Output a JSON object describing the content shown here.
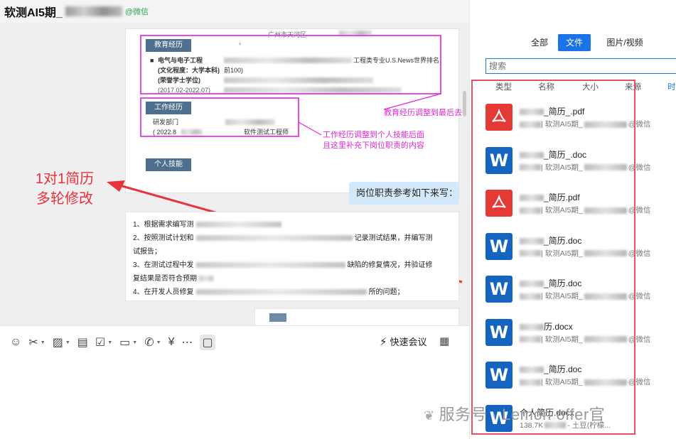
{
  "title": {
    "text": "软测AI5期_",
    "source": "@微信"
  },
  "resume": {
    "education_label": "教育经历",
    "work_label": "工作经历",
    "skills_label": "个人技能",
    "school_line": "电气与电子工程",
    "degree_line": "(文化程度：大学本科)",
    "bachelor_line": "(荣誉学士学位)",
    "date_line": "(2017.02-2022.07)",
    "rank_line": "工程类专业U.S.News世界排名",
    "rank_sub": "前100)",
    "work_dept": "研发部门",
    "work_date": "( 2022.8",
    "work_title": "软件测试工程师",
    "location": "广州市天河区",
    "edu_note": "教育经历调整到最后去",
    "work_note_1": "工作经历调整到个人技能后面",
    "work_note_2": "且这里补充下岗位职责的内容"
  },
  "annotation": {
    "line1": "1对1简历",
    "line2": "多轮修改"
  },
  "chat": {
    "bubble": "岗位职责参考如下来写：",
    "duties": [
      {
        "n": "1、根据需求编写测",
        "tail": ""
      },
      {
        "n": "2、按照测试计划和",
        "tail": "记录测试结果，并编写测"
      },
      {
        "n": "试报告；",
        "tail": ""
      },
      {
        "n": "3、在测试过程中发",
        "tail": "缺陷的修复情况，并验证修"
      },
      {
        "n": "复结果是否符合预期",
        "tail": ""
      },
      {
        "n": "4、在开发人员修复",
        "tail": "所的问题；"
      }
    ]
  },
  "toolbar": {
    "meeting": "快速会议"
  },
  "right_panel": {
    "tabs": [
      "全部",
      "文件",
      "图片/视频"
    ],
    "active_tab": 1,
    "search_placeholder": "搜索",
    "columns": [
      "类型",
      "名称",
      "大小",
      "来源",
      "时"
    ],
    "files": [
      {
        "type": "pdf",
        "name": "_简历_.pdf",
        "meta_mid": "| 软测AI5期_",
        "meta_end": "@微信"
      },
      {
        "type": "doc",
        "name": "_简历_.doc",
        "meta_mid": "| 软测AI5期_",
        "meta_end": "@微信"
      },
      {
        "type": "pdf",
        "name": "_简历.pdf",
        "meta_mid": "| 软测AI5期_",
        "meta_end": "@微信"
      },
      {
        "type": "doc",
        "name": "_简历.doc",
        "meta_mid": "| 软测AI5期_",
        "meta_end": "@微信"
      },
      {
        "type": "doc",
        "name": "_简历.doc",
        "meta_mid": "| 软测AI5期_",
        "meta_end": "@微信"
      },
      {
        "type": "doc",
        "name": "历.docx",
        "meta_mid": "| 软测AI5期_",
        "meta_end": "@微信"
      },
      {
        "type": "doc",
        "name": "_简历.doc",
        "meta_mid": "| 软测AI5期_",
        "meta_end": "@微信"
      },
      {
        "type": "doc",
        "name": "个人简历.docx",
        "meta_mid": "138.7K",
        "meta_end": "- 土豆(柠檬..."
      }
    ]
  },
  "watermark": {
    "text": "服务号 · Lemon offer官"
  },
  "colors": {
    "accent": "#1a73e8",
    "pdf": "#e53935",
    "doc": "#1565c0",
    "annot": "#e8323c",
    "magenta": "#e028d6"
  }
}
